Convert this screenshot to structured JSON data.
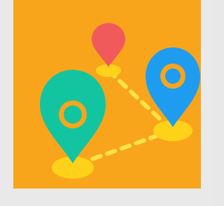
{
  "image": {
    "background_color": "#e9e9e9",
    "tile_color": "#f8a51c"
  },
  "icons": {
    "route_icon": "route-map-pins-icon",
    "pin_red": "map-pin-icon",
    "pin_blue": "map-pin-icon",
    "pin_green": "map-pin-icon"
  },
  "colors": {
    "pin_red": "#f05a5a",
    "pin_blue": "#1e9cf0",
    "pin_green": "#12c5a0",
    "route": "#ffe24a",
    "pin_shadow": "#ffd21a",
    "hole": "#f8a51c"
  }
}
